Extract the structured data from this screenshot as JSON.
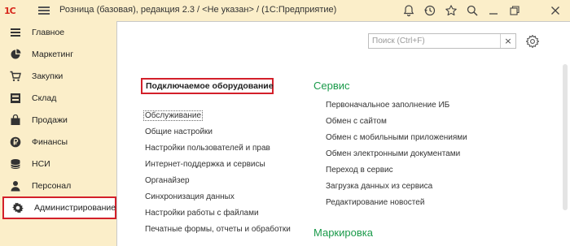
{
  "window": {
    "title": "Розница (базовая), редакция 2.3 / <Не указан> / (1С:Предприятие)",
    "logo_text": "1С"
  },
  "titlebar_icons": [
    "bell-icon",
    "history-icon",
    "star-icon",
    "search-icon",
    "minimize-icon",
    "restore-icon",
    "close-icon"
  ],
  "sidebar": {
    "items": [
      {
        "label": "Главное",
        "icon": "menu-icon"
      },
      {
        "label": "Маркетинг",
        "icon": "pie-chart-icon"
      },
      {
        "label": "Закупки",
        "icon": "cart-icon"
      },
      {
        "label": "Склад",
        "icon": "warehouse-icon"
      },
      {
        "label": "Продажи",
        "icon": "shopping-bag-icon"
      },
      {
        "label": "Финансы",
        "icon": "ruble-icon"
      },
      {
        "label": "НСИ",
        "icon": "database-icon"
      },
      {
        "label": "Персонал",
        "icon": "person-icon"
      },
      {
        "label": "Администрирование",
        "icon": "gear-icon",
        "active": true
      }
    ]
  },
  "search": {
    "placeholder": "Поиск (Ctrl+F)",
    "clear_label": "×"
  },
  "left_section": {
    "title": "Подключаемое оборудование",
    "links": [
      "Обслуживание",
      "Общие настройки",
      "Настройки пользователей и прав",
      "Интернет-поддержка и сервисы",
      "Органайзер",
      "Синхронизация данных",
      "Настройки работы с файлами",
      "Печатные формы, отчеты и обработки"
    ]
  },
  "right_section": {
    "title": "Сервис",
    "links": [
      "Первоначальное заполнение ИБ",
      "Обмен с сайтом",
      "Обмен с мобильными приложениями",
      "Обмен электронными документами",
      "Переход в сервис",
      "Загрузка данных из сервиса",
      "Редактирование новостей"
    ]
  },
  "right_section_2": {
    "title": "Маркировка"
  },
  "colors": {
    "sidebar_bg": "#fbeec9",
    "highlight": "#d3202a",
    "section_heading": "#1a9a4a",
    "logo": "#d7261a"
  }
}
